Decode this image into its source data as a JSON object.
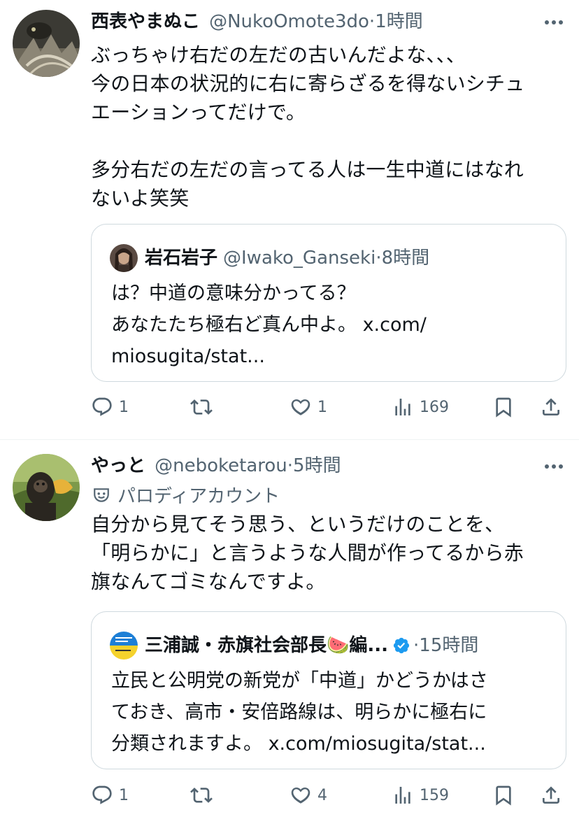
{
  "tweets": [
    {
      "name": "西表やまぬこ",
      "handle": "@NukoOmote3do",
      "time": "1時間",
      "text": "ぶっちゃけ右だの左だの古いんだよな、、、\n今の日本の状況的に右に寄らざるを得ないシチュ\nエーションってだけで。\n\n多分右だの左だの言ってる人は一生中道にはなれ\nないよ笑笑",
      "quote": {
        "name": "岩石岩子",
        "handle": "@Iwako_Ganseki",
        "time": "8時間",
        "text": "は？中道の意味分かってる？\nあなたたち極右ど真ん中よ。 x.com/\nmiosugita/stat..."
      },
      "stats": {
        "replies": "1",
        "reposts": "",
        "likes": "1",
        "views": "169"
      }
    },
    {
      "name": "やっと",
      "handle": "@neboketarou",
      "time": "5時間",
      "label": "パロディアカウント",
      "text": "自分から見てそう思う、というだけのことを、\n「明らかに」と言うような人間が作ってるから赤\n旗なんてゴミなんですよ。",
      "quote": {
        "name": "三浦誠・赤旗社会部長🍉編...",
        "handle": "",
        "time": "15時間",
        "text": "立民と公明党の新党が「中道」かどうかはさ\nておき、高市・安倍路線は、明らかに極右に\n分類されますよ。 x.com/miosugita/stat..."
      },
      "stats": {
        "replies": "1",
        "reposts": "",
        "likes": "4",
        "views": "159"
      }
    }
  ],
  "separator": "·",
  "colors": {
    "text": "#0f1419",
    "muted": "#536471",
    "border": "#cfd9de",
    "verified": "#1d9bf0"
  }
}
